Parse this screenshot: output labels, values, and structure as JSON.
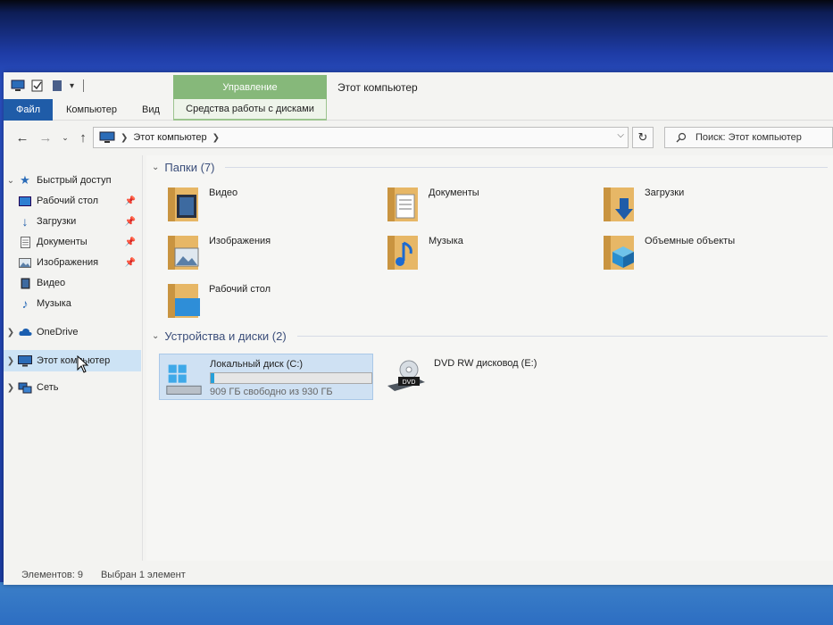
{
  "window": {
    "title": "Этот компьютер",
    "context_tab_header": "Управление"
  },
  "ribbon": {
    "tabs": {
      "file": "Файл",
      "computer": "Компьютер",
      "view": "Вид",
      "disk_tools": "Средства работы с дисками"
    }
  },
  "address": {
    "path": "Этот компьютер",
    "search_placeholder": "Поиск: Этот компьютер"
  },
  "nav": {
    "quick_access": "Быстрый доступ",
    "items": [
      {
        "label": "Рабочий стол",
        "icon": "desktop-icon",
        "pinned": true
      },
      {
        "label": "Загрузки",
        "icon": "download-icon",
        "pinned": true
      },
      {
        "label": "Документы",
        "icon": "documents-icon",
        "pinned": true
      },
      {
        "label": "Изображения",
        "icon": "pictures-icon",
        "pinned": true
      },
      {
        "label": "Видео",
        "icon": "video-icon",
        "pinned": false
      },
      {
        "label": "Музыка",
        "icon": "music-icon",
        "pinned": false
      }
    ],
    "onedrive": "OneDrive",
    "this_pc": "Этот компьютер",
    "network": "Сеть"
  },
  "content": {
    "folders_header": "Папки (7)",
    "folders": [
      {
        "label": "Видео",
        "icon": "video-folder-icon"
      },
      {
        "label": "Документы",
        "icon": "documents-folder-icon"
      },
      {
        "label": "Загрузки",
        "icon": "downloads-folder-icon"
      },
      {
        "label": "Изображения",
        "icon": "pictures-folder-icon"
      },
      {
        "label": "Музыка",
        "icon": "music-folder-icon"
      },
      {
        "label": "Объемные объекты",
        "icon": "3d-objects-folder-icon"
      },
      {
        "label": "Рабочий стол",
        "icon": "desktop-folder-icon"
      }
    ],
    "devices_header": "Устройства и диски (2)",
    "drives": [
      {
        "label": "Локальный диск (C:)",
        "free": "909 ГБ свободно из 930 ГБ",
        "used_fraction": 0.0226
      },
      {
        "label": "DVD RW дисковод (E:)"
      }
    ]
  },
  "status": {
    "count": "Элементов: 9",
    "selected": "Выбран 1 элемент"
  },
  "colors": {
    "accent": "#1f5ca8",
    "context_green": "#86b87a",
    "selection": "#cde3f5",
    "drive_bar": "#26a0da",
    "group_header": "#3b4e7a"
  }
}
